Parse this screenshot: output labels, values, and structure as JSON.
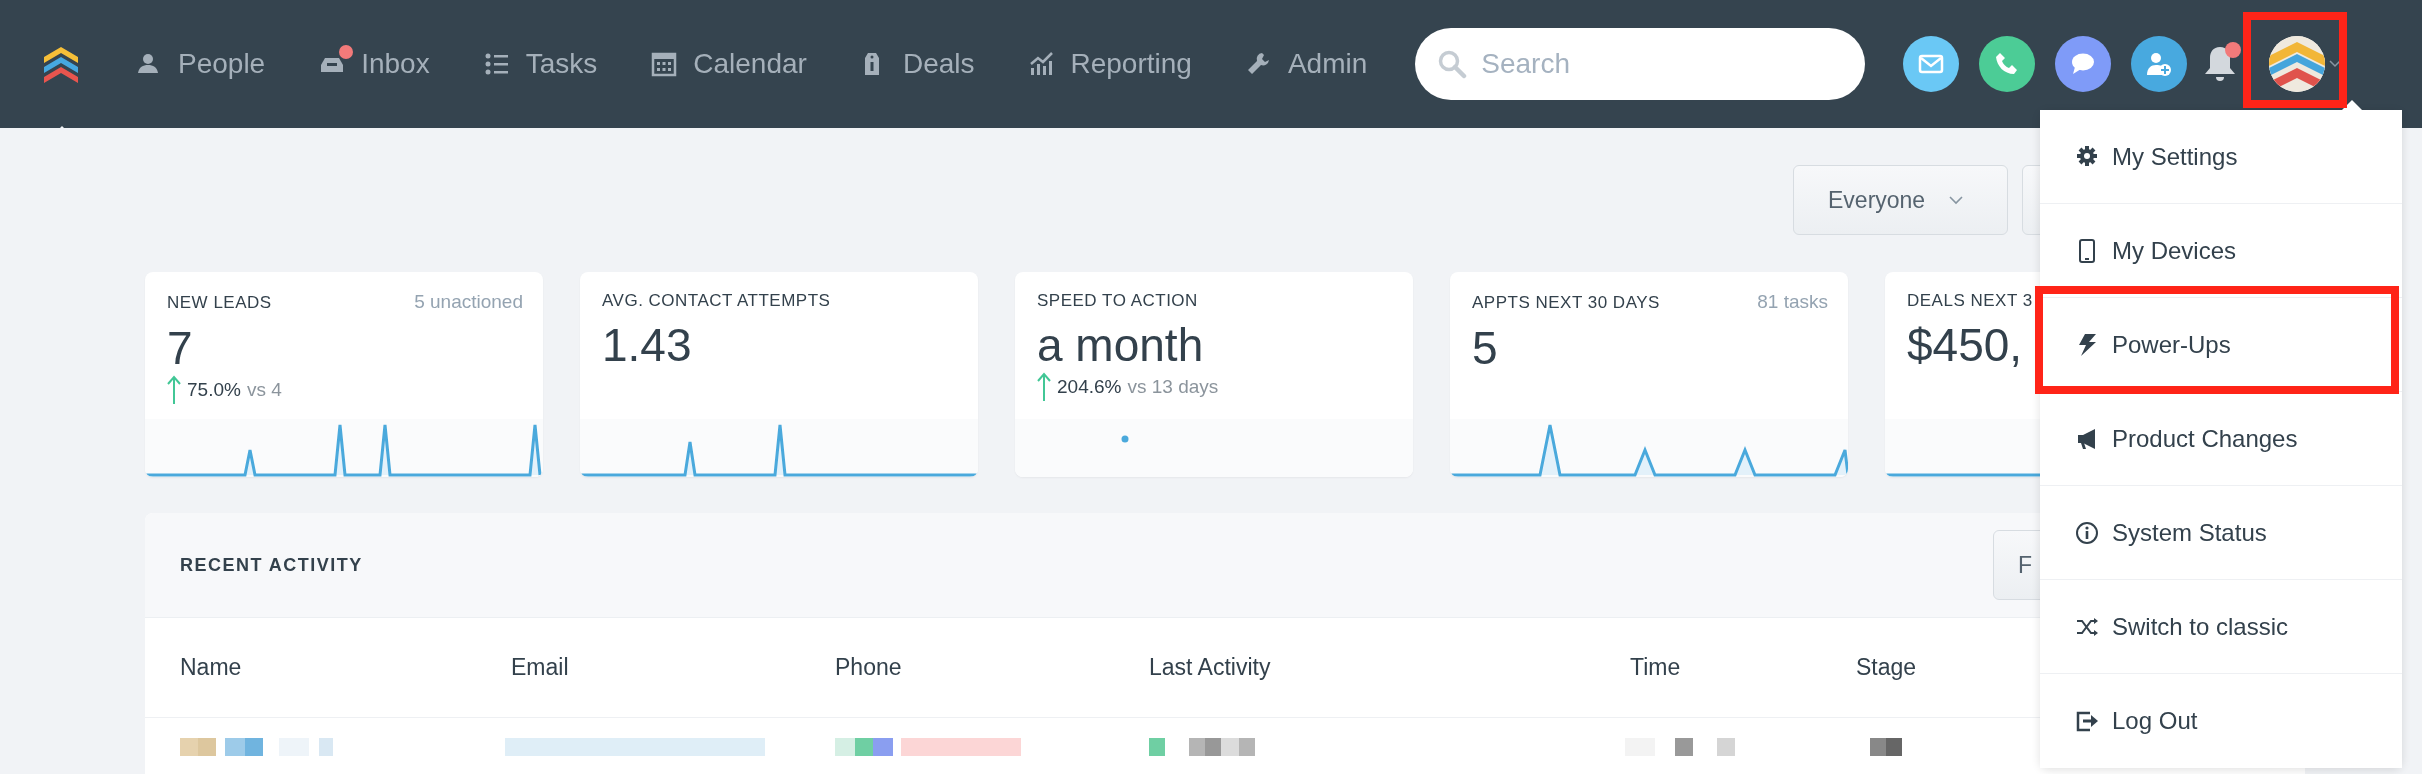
{
  "nav": {
    "logo": {
      "selected": true
    },
    "items": [
      {
        "label": "People",
        "selected": false,
        "notification": false
      },
      {
        "label": "Inbox",
        "selected": false,
        "notification": true
      },
      {
        "label": "Tasks",
        "selected": false,
        "notification": false
      },
      {
        "label": "Calendar",
        "selected": false,
        "notification": false
      },
      {
        "label": "Deals",
        "selected": false,
        "notification": false
      },
      {
        "label": "Reporting",
        "selected": false,
        "notification": false
      },
      {
        "label": "Admin",
        "selected": false,
        "notification": false
      }
    ]
  },
  "search": {
    "placeholder": "Search"
  },
  "actions": [
    {
      "kind": "email",
      "color": "#6ac8f5"
    },
    {
      "kind": "phone",
      "color": "#4ccc96"
    },
    {
      "kind": "chat",
      "color": "#7f9bf8"
    },
    {
      "kind": "add_person",
      "color": "#48a9df"
    }
  ],
  "notifications": {
    "unread": true
  },
  "user_menu": {
    "open": true,
    "highlighted": true,
    "items": [
      {
        "label": "My Settings",
        "highlighted": false
      },
      {
        "label": "My Devices",
        "highlighted": false
      },
      {
        "label": "Power-Ups",
        "highlighted": true
      },
      {
        "label": "Product Changes",
        "highlighted": false
      },
      {
        "label": "System Status",
        "highlighted": false
      },
      {
        "label": "Switch to classic",
        "highlighted": false
      },
      {
        "label": "Log Out",
        "highlighted": false
      }
    ]
  },
  "filters": [
    {
      "kind": "dropdown",
      "label": "Everyone"
    },
    {
      "kind": "blank"
    }
  ],
  "stats": [
    {
      "title": "NEW LEADS",
      "note": "5 unactioned",
      "value": "7",
      "change": "75.0%",
      "comparison": "vs 4"
    },
    {
      "title": "AVG. CONTACT ATTEMPTS",
      "value": "1.43"
    },
    {
      "title": "SPEED TO ACTION",
      "value": "a month",
      "change": "204.6%",
      "comparison": "vs 13 days"
    },
    {
      "title": "APPTS NEXT 30 DAYS",
      "note": "81 tasks",
      "value": "5"
    },
    {
      "title": "DEALS NEXT 3",
      "value": "$450,"
    }
  ],
  "recent_activity": {
    "title": "RECENT ACTIVITY",
    "button_label": "F",
    "columns": [
      "Name",
      "Email",
      "Phone",
      "Last Activity",
      "Time",
      "Stage"
    ]
  }
}
